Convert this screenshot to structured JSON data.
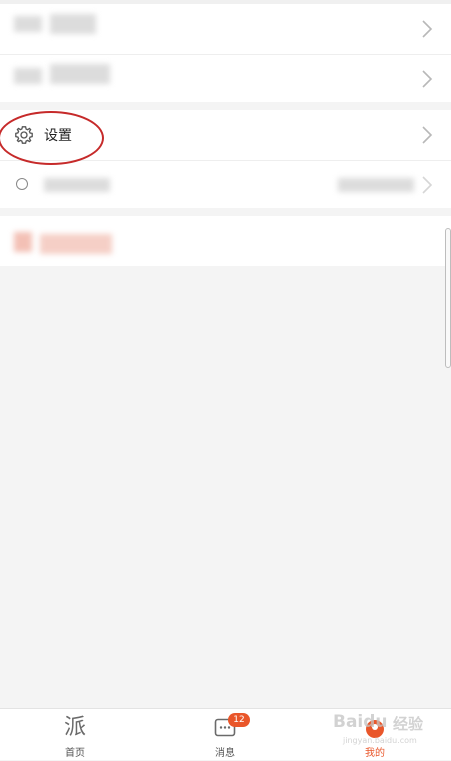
{
  "settings_row": {
    "label": "设置"
  },
  "tabbar": {
    "tabs": [
      {
        "label": "首页",
        "icon": "pai-logo-icon"
      },
      {
        "label": "消息",
        "icon": "message-icon"
      },
      {
        "label": "我的",
        "icon": "profile-icon"
      }
    ],
    "badge": "12"
  },
  "watermark": {
    "brand": "Baidu",
    "suffix": "经验",
    "url": "jingyan.baidu.com"
  },
  "colors": {
    "accent": "#e9562a",
    "annotation_circle": "#c62a2a",
    "page_background": "#f4f4f4",
    "row_background": "#ffffff"
  }
}
